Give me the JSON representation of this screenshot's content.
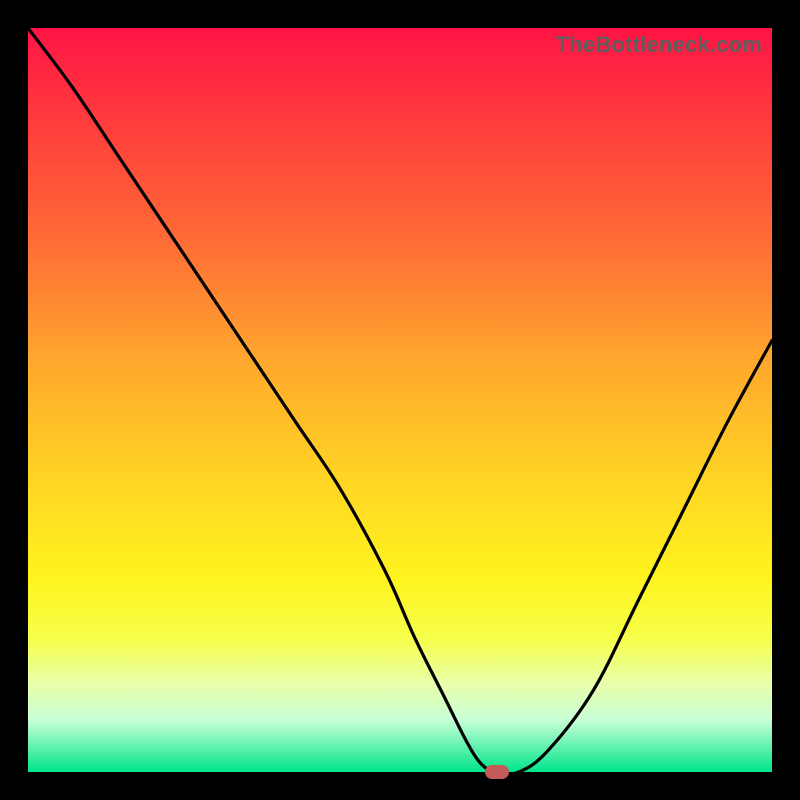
{
  "watermark": "TheBottleneck.com",
  "chart_data": {
    "type": "line",
    "title": "",
    "xlabel": "",
    "ylabel": "",
    "xlim": [
      0,
      100
    ],
    "ylim": [
      0,
      100
    ],
    "grid": false,
    "legend": false,
    "series": [
      {
        "name": "bottleneck-curve",
        "x": [
          0,
          6,
          12,
          18,
          24,
          30,
          36,
          42,
          48,
          52,
          56,
          59,
          61,
          63,
          66,
          70,
          76,
          82,
          88,
          94,
          100
        ],
        "y": [
          100,
          92,
          83,
          74,
          65,
          56,
          47,
          38,
          27,
          18,
          10,
          4,
          1,
          0,
          0,
          3,
          11,
          23,
          35,
          47,
          58
        ]
      }
    ],
    "marker": {
      "x": 63,
      "y": 0,
      "color": "#c55a5a"
    },
    "gradient_stops": [
      {
        "pos": 0,
        "color": "#ff1445"
      },
      {
        "pos": 12,
        "color": "#ff3a3d"
      },
      {
        "pos": 28,
        "color": "#ff6a36"
      },
      {
        "pos": 45,
        "color": "#ffa82d"
      },
      {
        "pos": 60,
        "color": "#ffd324"
      },
      {
        "pos": 74,
        "color": "#fff41e"
      },
      {
        "pos": 82,
        "color": "#f6ff4a"
      },
      {
        "pos": 88,
        "color": "#e9ffa8"
      },
      {
        "pos": 93,
        "color": "#c8ffd6"
      },
      {
        "pos": 100,
        "color": "#00e58a"
      }
    ]
  }
}
